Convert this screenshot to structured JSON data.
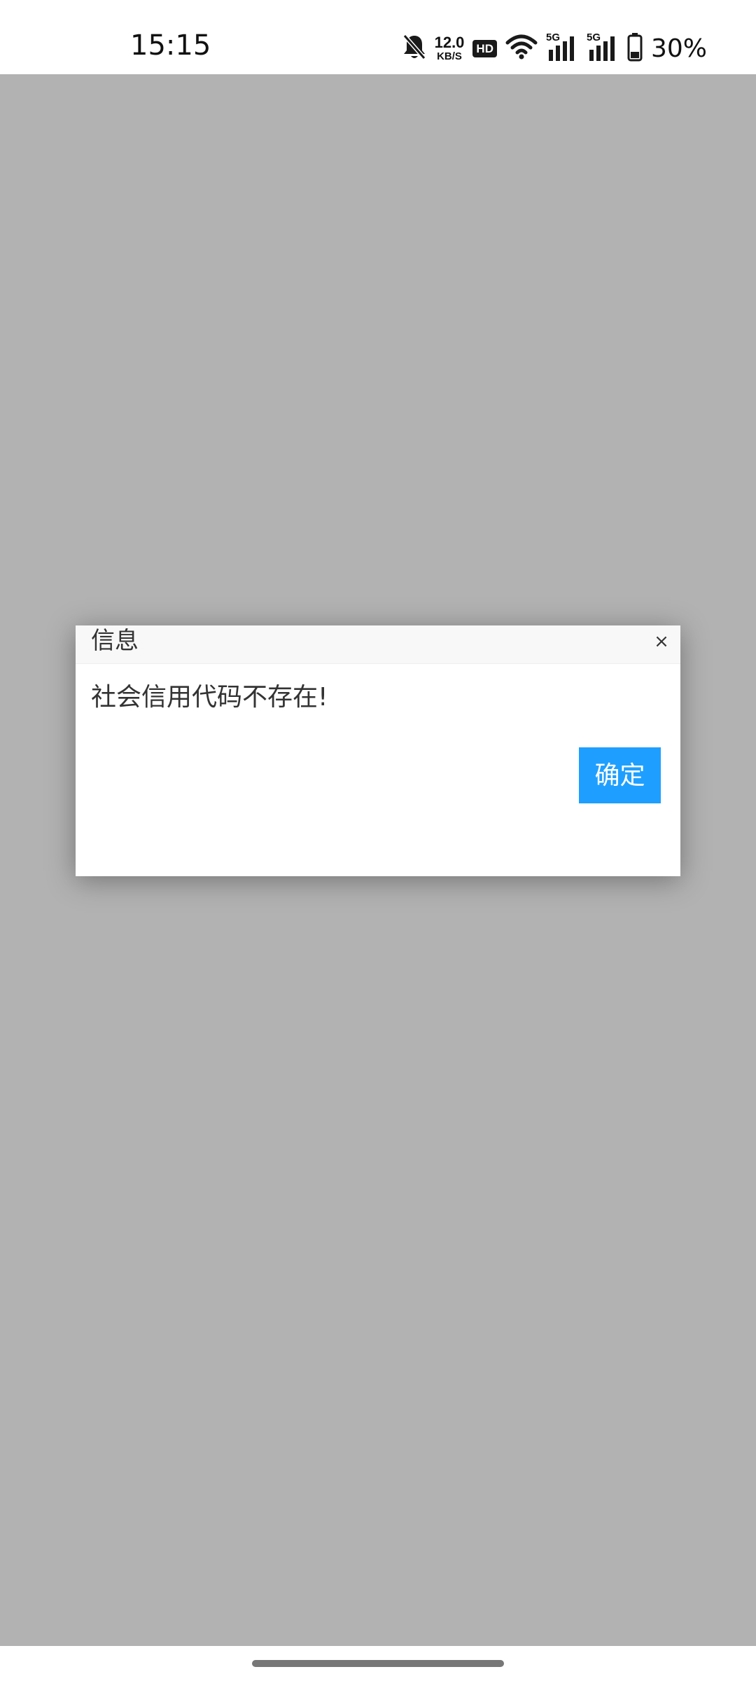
{
  "status_bar": {
    "time": "15:15",
    "net_speed_value": "12.0",
    "net_speed_unit": "KB/S",
    "hd_label": "HD",
    "sim1_label": "5G",
    "sim2_label": "5G",
    "battery_percent": "30%",
    "icons": [
      "bell-muted-icon",
      "wifi-icon",
      "signal-icon",
      "battery-icon"
    ]
  },
  "dialog": {
    "title": "信息",
    "close_glyph": "×",
    "message": "社会信用代码不存在!",
    "ok_label": "确定",
    "accent_color": "#1e9fff"
  },
  "overlay_color": "#b2b2b2"
}
